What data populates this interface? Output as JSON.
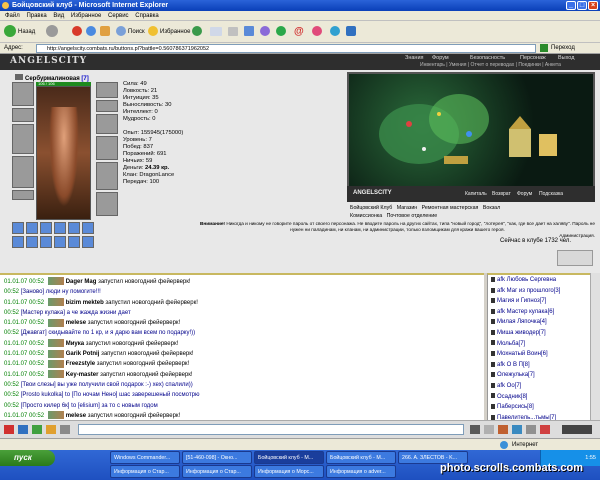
{
  "window": {
    "title": "Бойцовский клуб - Microsoft Internet Explorer"
  },
  "menu": [
    "Файл",
    "Правка",
    "Вид",
    "Избранное",
    "Сервис",
    "Справка"
  ],
  "toolbar": {
    "back": "Назад",
    "search": "Поиск",
    "favorites": "Избранное"
  },
  "address": {
    "url": "http://angelscity.combats.ru/buttons.pl?battle=0.560786371962052",
    "go": "Переход"
  },
  "game": {
    "logo": "ANGELSCITY",
    "nav_top": [
      "Знания",
      "Форум",
      "Безопасность",
      "Персонаж",
      "Выход"
    ],
    "nav_sub": "Инвентарь | Умения | Отчет о переводах | Поединки | Анкета",
    "character": {
      "name": "Сербурмалиновая",
      "level": "[7]",
      "hp": "106 / 106"
    },
    "stats": [
      {
        "label": "Сила:",
        "value": "49"
      },
      {
        "label": "Ловкость:",
        "value": "21"
      },
      {
        "label": "Интуиция:",
        "value": "35"
      },
      {
        "label": "Выносливость:",
        "value": "30"
      },
      {
        "label": "Интеллект:",
        "value": "0"
      },
      {
        "label": "Мудрость:",
        "value": "0"
      },
      {
        "label": "",
        "value": ""
      },
      {
        "label": "Опыт:",
        "value": "155945(175000)"
      },
      {
        "label": "Уровень:",
        "value": "7"
      },
      {
        "label": "Побед:",
        "value": "837"
      },
      {
        "label": "Поражений:",
        "value": "691"
      },
      {
        "label": "Ничьих:",
        "value": "59"
      },
      {
        "label": "Деньги:",
        "value": "24.39 кр."
      },
      {
        "label": "Клан:",
        "value": "DragonLance"
      },
      {
        "label": "Передач:",
        "value": "100"
      }
    ],
    "scene_links": [
      "Капиталь",
      "Возврат",
      "Форум",
      "Подсказка"
    ],
    "locations": [
      "Бойцовский Клуб",
      "Магазин",
      "Ремонтная мастерская",
      "Вокзал",
      "Комиссионка",
      "Почтовое отделение"
    ],
    "warning_title": "Внимание!",
    "warning_text": "Никогда и никому не говорите пароль от своего персонажа. Не вводите пароль на других сайтах, типа \"новый город\", \"лотерея\", \"как, где все дает на халяву\". Пароль не нужен ни паладинам, ни кланам, ни администрации, только взломщикам для кражи вашего героя.",
    "warning_sign": "Администрация.",
    "online": "Сейчас в клубе 1732 чел."
  },
  "chat": [
    {
      "time": "01.01.07 00:52",
      "nick": "Dager Mag",
      "text": "запустил новогодний фейерверк!"
    },
    {
      "time": "00:52",
      "nick": "[Заново]",
      "text": "люди ну помогите!!!"
    },
    {
      "time": "01.01.07 00:52",
      "nick": "bizim mekteb",
      "text": "запустил новогодний фейерверк!"
    },
    {
      "time": "00:52",
      "nick": "[Мастер кулака]",
      "text": "а че жажда жизни дает"
    },
    {
      "time": "01.01.07 00:52",
      "nick": "melese",
      "text": "запустил новогодний фейерверк!"
    },
    {
      "time": "00:52",
      "nick": "[Джавгат]",
      "text": "скидывайте по 1 кр, и я дарю вам всем по подарку!))"
    },
    {
      "time": "01.01.07 00:52",
      "nick": "Миука",
      "text": "запустил новогодний фейерверк!"
    },
    {
      "time": "01.01.07 00:52",
      "nick": "Garik Potnij",
      "text": "запустил новогодний фейерверк!"
    },
    {
      "time": "01.01.07 00:52",
      "nick": "Freezstyle",
      "text": "запустил новогодний фейерверк!"
    },
    {
      "time": "01.01.07 00:52",
      "nick": "Key-master",
      "text": "запустил новогодний фейерверк!"
    },
    {
      "time": "00:52",
      "nick": "[Твои слезы]",
      "text": "вы уже получили свой подарок :-) хех) спалили))"
    },
    {
      "time": "00:52",
      "nick": "[Prosto kukolka]",
      "text": "to [По ночам Нено] шас заверешеный посмотрю"
    },
    {
      "time": "00:52",
      "nick": "[Просто килер 6к]",
      "text": "to [elisium] за то с новым годом"
    },
    {
      "time": "01.01.07 00:52",
      "nick": "melese",
      "text": "запустил новогодний фейерверк!"
    }
  ],
  "users": [
    "afk Любовь Сергевна",
    "afk Маг из прошлого[3]",
    "Магия и Гипноз[7]",
    "afk Мастер кулака[6]",
    "Милая Ляпочка[4]",
    "Миша живодер[7]",
    "Мольба[7]",
    "Мохнатый Воин[6]",
    "afk О В П[8]",
    "Олежулька[7]",
    "afk Оо[7]",
    "Осадник[8]",
    "Паберсись[8]",
    "Павелитель...тьмы[7]",
    "ПальПетрович[7]",
    "Паникер[7]"
  ],
  "status": {
    "left": "",
    "right": "Интернет"
  },
  "taskbar": {
    "start": "пуск",
    "tasks": [
      "Windows Commander...",
      "[51-460-098] - Окно...",
      "Бойцовский клуб - M...",
      "Бойцовский клуб - M...",
      "266. A. ЗЛЕСТОВ - K...",
      "Информация о Стар...",
      "Информация о Стар...",
      "Информация о Морс...",
      "Информация о adver..."
    ],
    "clock": "1:55"
  },
  "watermark": "photo.scrolls.combats.com"
}
